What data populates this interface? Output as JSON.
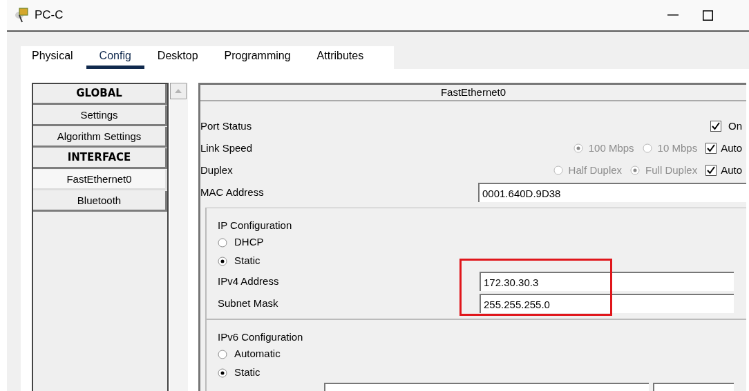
{
  "window": {
    "title": "PC-C"
  },
  "tabs": [
    {
      "label": "Physical",
      "selected": false
    },
    {
      "label": "Config",
      "selected": true
    },
    {
      "label": "Desktop",
      "selected": false
    },
    {
      "label": "Programming",
      "selected": false
    },
    {
      "label": "Attributes",
      "selected": false
    }
  ],
  "sidebar": {
    "items": [
      {
        "label": "GLOBAL",
        "kind": "header",
        "selected": false
      },
      {
        "label": "Settings",
        "kind": "item",
        "selected": false
      },
      {
        "label": "Algorithm Settings",
        "kind": "item",
        "selected": false
      },
      {
        "label": "INTERFACE",
        "kind": "header",
        "selected": false
      },
      {
        "label": "FastEthernet0",
        "kind": "item",
        "selected": true
      },
      {
        "label": "Bluetooth",
        "kind": "item",
        "selected": false
      }
    ]
  },
  "panel": {
    "title": "FastEthernet0",
    "port_status": {
      "label": "Port Status",
      "on": {
        "label": "On",
        "checked": true
      }
    },
    "link_speed": {
      "label": "Link Speed",
      "disabled": true,
      "options": [
        {
          "label": "100 Mbps",
          "selected": true
        },
        {
          "label": "10 Mbps",
          "selected": false
        }
      ],
      "auto": {
        "label": "Auto",
        "checked": true
      }
    },
    "duplex": {
      "label": "Duplex",
      "disabled": true,
      "options": [
        {
          "label": "Half Duplex",
          "selected": false
        },
        {
          "label": "Full Duplex",
          "selected": true
        }
      ],
      "auto": {
        "label": "Auto",
        "checked": true
      }
    },
    "mac": {
      "label": "MAC Address",
      "value": "0001.640D.9D38"
    },
    "ip_config": {
      "title": "IP Configuration",
      "highlighted": true,
      "modes": [
        {
          "label": "DHCP",
          "selected": false
        },
        {
          "label": "Static",
          "selected": true
        }
      ],
      "fields": [
        {
          "label": "IPv4 Address",
          "value": "172.30.30.3"
        },
        {
          "label": "Subnet Mask",
          "value": "255.255.255.0"
        }
      ]
    },
    "ipv6_config": {
      "title": "IPv6 Configuration",
      "modes": [
        {
          "label": "Automatic",
          "selected": false
        },
        {
          "label": "Static",
          "selected": true
        }
      ]
    }
  }
}
